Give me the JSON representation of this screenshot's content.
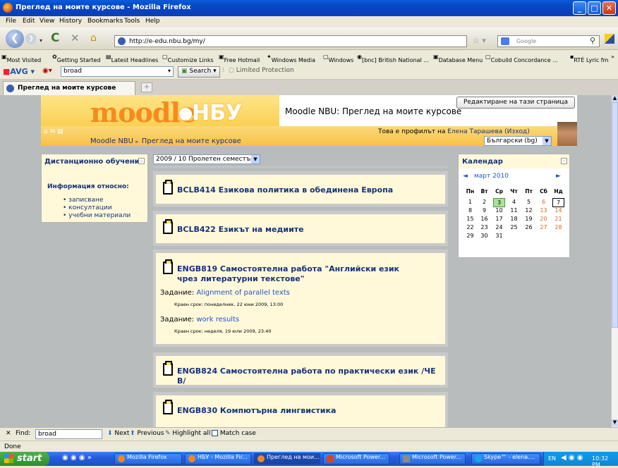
{
  "window": {
    "title": "Преглед на моите курсове - Mozilla Firefox"
  },
  "menu": [
    "File",
    "Edit",
    "View",
    "History",
    "Bookmarks",
    "Tools",
    "Help"
  ],
  "nav": {
    "url": "http://e-edu.nbu.bg/my/",
    "search_placeholder": "Google"
  },
  "bookmarks": [
    "Most Visited",
    "Getting Started",
    "Latest Headlines",
    "Customize Links",
    "Free Hotmail",
    "Windows Media",
    "Windows",
    "[bnc] British National ...",
    "Database Menu",
    "Cobuild Concordance ...",
    "RTÉ Lyric fm"
  ],
  "avgbar": {
    "brand": "AVG",
    "search_value": "broad",
    "search_button": "Search",
    "protection": "Limited Protection"
  },
  "tab": {
    "label": "Преглед на моите курсове"
  },
  "header": {
    "logo": "moodle",
    "logo_suffix": "НБУ",
    "heading": "Moodle NBU: Преглед на моите курсове",
    "edit_button": "Редактиране на тази страница",
    "breadcrumb_root": "Moodle NBU",
    "breadcrumb_sep": "►",
    "breadcrumb_current": "Преглед на моите курсове",
    "login_prefix": "Това е профилът на",
    "user_name": "Елена Тарашева",
    "logout": "(Изход)",
    "language": "Български (bg)"
  },
  "left_block": {
    "title": "Дистанционно обучение",
    "subtitle": "Информация относно:",
    "items": [
      "записване",
      "консултации",
      "учебни материали"
    ]
  },
  "semester": "2009 / 10 Пролетен семестър",
  "courses": [
    {
      "title": "BCLB414 Езикова политика в обединена Европа"
    },
    {
      "title": "BCLB422 Езикът на медиите"
    },
    {
      "title": "ENGB819 Самостоятелна работа \"Английски език чрез литературни текстове\"",
      "assignments": [
        {
          "label": "Задание:",
          "name": "Alignment of parallel texts",
          "deadline": "Краен срок: понеделник, 22 юни 2009, 13:00"
        },
        {
          "label": "Задание:",
          "name": "work results",
          "deadline": "Краен срок: неделя, 19 юли 2009, 23:40"
        }
      ]
    },
    {
      "title": "ENGB824 Самостоятелна работа по практически език /ЧЕ В/"
    },
    {
      "title": "ENGB830 Компютърна лингвистика"
    }
  ],
  "calendar": {
    "title": "Календар",
    "month": "март 2010",
    "prev": "◄",
    "next": "►",
    "weekdays": [
      "Пн",
      "Вт",
      "Ср",
      "Чт",
      "Пт",
      "Сб",
      "Нд"
    ],
    "weeks": [
      [
        "1",
        "2",
        "3",
        "4",
        "5",
        "6",
        "7"
      ],
      [
        "8",
        "9",
        "10",
        "11",
        "12",
        "13",
        "14"
      ],
      [
        "15",
        "16",
        "17",
        "18",
        "19",
        "20",
        "21"
      ],
      [
        "22",
        "23",
        "24",
        "25",
        "26",
        "27",
        "28"
      ],
      [
        "29",
        "30",
        "31",
        "",
        "",
        "",
        ""
      ]
    ],
    "highlight_day": "3",
    "today": "7"
  },
  "findbar": {
    "label": "Find:",
    "value": "broad",
    "next": "Next",
    "previous": "Previous",
    "highlight": "Highlight all",
    "match_case": "Match case"
  },
  "status": "Done",
  "taskbar": {
    "start": "start",
    "items": [
      "Mozilla Firefox",
      "НБУ - Mozilla Fir...",
      "Преглед на мои...",
      "Microsoft Power...",
      "Microsoft Power...",
      "Skype™ - elena...."
    ],
    "lang": "EN",
    "clock": "10:32 PM"
  },
  "colors": {
    "titlebar": "#0a4fd0",
    "moodle_orange": "#f58a1f",
    "link_blue": "#15317e",
    "block_bg": "#fff9d9"
  }
}
